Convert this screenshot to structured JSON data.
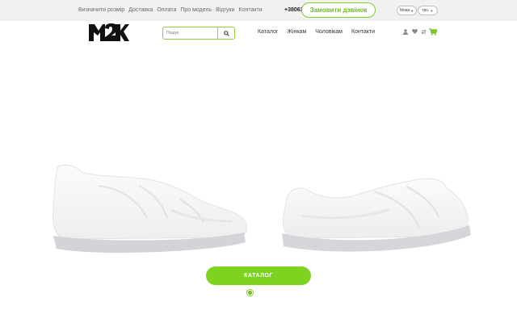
{
  "topbar": {
    "links": [
      "Визначити розмір",
      "Доставка",
      "Оплата",
      "Про модель",
      "Відгуки",
      "Контакти"
    ],
    "phone": "+38063",
    "callback_label": "Замовити дзвінок",
    "language": "Мова",
    "currency": "грн."
  },
  "header": {
    "logo_text": "M2K",
    "search": {
      "placeholder": "Пошук"
    },
    "nav": [
      "Каталог",
      "Жінкам",
      "Чоловікам",
      "Контакти"
    ],
    "icons": [
      "user-icon",
      "heart-icon",
      "compare-icon",
      "cart-icon"
    ]
  },
  "hero": {
    "catalog_label": "КАТАЛОГ",
    "slider": {
      "total": 1,
      "active": 1
    }
  },
  "colors": {
    "accent": "#7ed321",
    "topbar_bg": "#f1f1f1",
    "logo": "#111111"
  }
}
